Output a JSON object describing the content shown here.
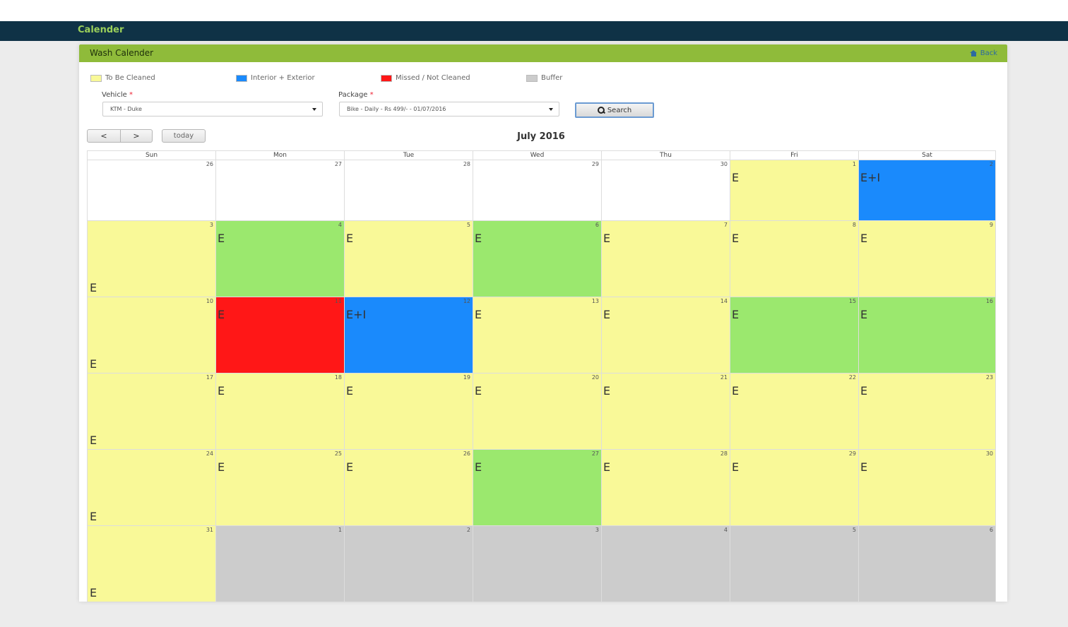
{
  "navbar": {
    "brand": "Calender"
  },
  "panel": {
    "title": "Wash Calender",
    "back_label": "Back"
  },
  "legend": [
    {
      "label": "To Be Cleaned",
      "color": "#f9f998"
    },
    {
      "label": "Interior + Exterior",
      "color": "#1a8afc"
    },
    {
      "label": "Missed / Not Cleaned",
      "color": "#ff1717"
    },
    {
      "label": "Buffer",
      "color": "#cccccc"
    }
  ],
  "filters": {
    "vehicle_label": "Vehicle",
    "vehicle_value": "KTM - Duke",
    "package_label": "Package",
    "package_value": "Bike - Daily - Rs 499/- - 01/07/2016",
    "search_label": "Search"
  },
  "calendar": {
    "prev_label": "<",
    "next_label": ">",
    "today_label": "today",
    "title": "July 2016",
    "days_of_week": [
      "Sun",
      "Mon",
      "Tue",
      "Wed",
      "Thu",
      "Fri",
      "Sat"
    ],
    "weeks": [
      [
        {
          "day": "26",
          "status": "white",
          "event": ""
        },
        {
          "day": "27",
          "status": "white",
          "event": ""
        },
        {
          "day": "28",
          "status": "white",
          "event": ""
        },
        {
          "day": "29",
          "status": "white",
          "event": ""
        },
        {
          "day": "30",
          "status": "white",
          "event": ""
        },
        {
          "day": "1",
          "status": "yellow",
          "event": "E"
        },
        {
          "day": "2",
          "status": "blue",
          "event": "E+I"
        }
      ],
      [
        {
          "day": "3",
          "status": "yellow",
          "event": "E",
          "bottom": true
        },
        {
          "day": "4",
          "status": "green",
          "event": "E"
        },
        {
          "day": "5",
          "status": "yellow",
          "event": "E"
        },
        {
          "day": "6",
          "status": "green",
          "event": "E"
        },
        {
          "day": "7",
          "status": "yellow",
          "event": "E"
        },
        {
          "day": "8",
          "status": "yellow",
          "event": "E"
        },
        {
          "day": "9",
          "status": "yellow",
          "event": "E"
        }
      ],
      [
        {
          "day": "10",
          "status": "yellow",
          "event": "E",
          "bottom": true
        },
        {
          "day": "11",
          "status": "red",
          "event": "E"
        },
        {
          "day": "12",
          "status": "blue",
          "event": "E+I"
        },
        {
          "day": "13",
          "status": "yellow",
          "event": "E"
        },
        {
          "day": "14",
          "status": "yellow",
          "event": "E"
        },
        {
          "day": "15",
          "status": "green",
          "event": "E"
        },
        {
          "day": "16",
          "status": "green",
          "event": "E"
        }
      ],
      [
        {
          "day": "17",
          "status": "yellow",
          "event": "E",
          "bottom": true
        },
        {
          "day": "18",
          "status": "yellow",
          "event": "E"
        },
        {
          "day": "19",
          "status": "yellow",
          "event": "E"
        },
        {
          "day": "20",
          "status": "yellow",
          "event": "E"
        },
        {
          "day": "21",
          "status": "yellow",
          "event": "E"
        },
        {
          "day": "22",
          "status": "yellow",
          "event": "E"
        },
        {
          "day": "23",
          "status": "yellow",
          "event": "E"
        }
      ],
      [
        {
          "day": "24",
          "status": "yellow",
          "event": "E",
          "bottom": true
        },
        {
          "day": "25",
          "status": "yellow",
          "event": "E"
        },
        {
          "day": "26",
          "status": "yellow",
          "event": "E"
        },
        {
          "day": "27",
          "status": "green",
          "event": "E"
        },
        {
          "day": "28",
          "status": "yellow",
          "event": "E"
        },
        {
          "day": "29",
          "status": "yellow",
          "event": "E"
        },
        {
          "day": "30",
          "status": "yellow",
          "event": "E"
        }
      ],
      [
        {
          "day": "31",
          "status": "yellow",
          "event": "E",
          "bottom": true
        },
        {
          "day": "1",
          "status": "grey",
          "event": ""
        },
        {
          "day": "2",
          "status": "grey",
          "event": ""
        },
        {
          "day": "3",
          "status": "grey",
          "event": ""
        },
        {
          "day": "4",
          "status": "grey",
          "event": ""
        },
        {
          "day": "5",
          "status": "grey",
          "event": ""
        },
        {
          "day": "6",
          "status": "grey",
          "event": ""
        }
      ]
    ]
  }
}
